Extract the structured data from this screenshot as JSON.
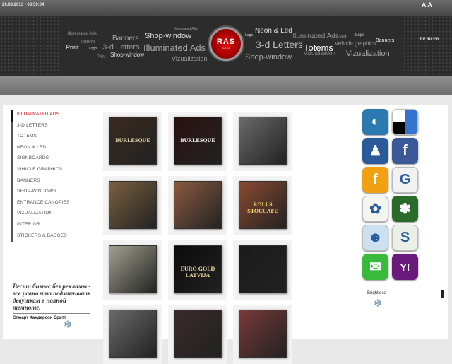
{
  "topbar": {
    "datetime": "29.03.2013 - 03:59:04",
    "font_size_control": "A A"
  },
  "header": {
    "logo_text": "RAS",
    "logo_subtext": "SIGNS",
    "langs": "Lv Ru En",
    "tag_cloud": [
      {
        "text": "Illuminated Ads",
        "color": "#9a9a9a"
      },
      {
        "text": "Banners",
        "color": "#aaaaaa"
      },
      {
        "text": "Shop-window",
        "color": "#e0e0e0"
      },
      {
        "text": "Illuminated Ads",
        "color": "#9a9a9a"
      },
      {
        "text": "Totems",
        "color": "#8a8a8a"
      },
      {
        "text": "Print",
        "color": "#ffffff"
      },
      {
        "text": "Logo",
        "color": "#cccccc"
      },
      {
        "text": "3-d Letters",
        "color": "#9a9a9a"
      },
      {
        "text": "Illuminated Ads",
        "color": "#a8a8a8"
      },
      {
        "text": "Print",
        "color": "#9a9a9a"
      },
      {
        "text": "Shop-window",
        "color": "#dddddd"
      },
      {
        "text": "Vizualization",
        "color": "#9a9a9a"
      },
      {
        "text": "Neon & Led",
        "color": "#dddddd"
      },
      {
        "text": "Logo",
        "color": "#cccccc"
      },
      {
        "text": "3-d Letters",
        "color": "#bbbbbb"
      },
      {
        "text": "Shop-window",
        "color": "#a8a8a8"
      },
      {
        "text": "Illuminated Ads",
        "color": "#999999"
      },
      {
        "text": "Print",
        "color": "#aaaaaa"
      },
      {
        "text": "Logo",
        "color": "#dddddd"
      },
      {
        "text": "Banners",
        "color": "#eeeeee"
      },
      {
        "text": "Totems",
        "color": "#ffffff"
      },
      {
        "text": "Vehicle graphics",
        "color": "#9a9a9a"
      },
      {
        "text": "Vizualization",
        "color": "#8a8a8a"
      },
      {
        "text": "Vizualization",
        "color": "#a8a8a8"
      }
    ]
  },
  "menu": [
    {
      "label": "ILLUMINATED ADS",
      "active": true
    },
    {
      "label": "3-D LETTERS",
      "active": false
    },
    {
      "label": "TOTEMS",
      "active": false
    },
    {
      "label": "NEON & LED",
      "active": false
    },
    {
      "label": "SIGNBOARDS",
      "active": false
    },
    {
      "label": "VIHICLE GRAPHICS",
      "active": false
    },
    {
      "label": "BANNERS",
      "active": false
    },
    {
      "label": "SHOP-WINDOWS",
      "active": false
    },
    {
      "label": "ENTRANCE CANOPIES",
      "active": false
    },
    {
      "label": "VIZUALIZATION",
      "active": false
    },
    {
      "label": "INTERIOR",
      "active": false
    },
    {
      "label": "STICKERS & BADGES",
      "active": false
    }
  ],
  "quote": {
    "text": "Вести бизнес без рекламы - все равно что подмигивать девушкам в полной темноте.",
    "author": "Стюарт Хандерсон Бритт"
  },
  "gallery": [
    {
      "sign": "BURLESQUE",
      "bg": "#3a2a20",
      "fg": "#e8d8b0"
    },
    {
      "sign": "BURLESQUE",
      "bg": "#2a1010",
      "fg": "#ffffff"
    },
    {
      "sign": "",
      "bg": "#6a6a6a",
      "fg": "#ffffff"
    },
    {
      "sign": "",
      "bg": "#7a6040",
      "fg": "#ffffff"
    },
    {
      "sign": "",
      "bg": "#8a5a40",
      "fg": "#ffffff"
    },
    {
      "sign": "ROLLS STOCCAFE",
      "bg": "#8a4a30",
      "fg": "#ffe070"
    },
    {
      "sign": "",
      "bg": "#a0a090",
      "fg": "#ffffff"
    },
    {
      "sign": "EURO GOLD LATVIJA",
      "bg": "#0a0a0a",
      "fg": "#f0e0a0"
    },
    {
      "sign": "",
      "bg": "#1a1a1a",
      "fg": "#ffffff"
    },
    {
      "sign": "",
      "bg": "#6a6a6a",
      "fg": "#ffffff"
    },
    {
      "sign": "",
      "bg": "#3a2a2a",
      "fg": "#ffffff"
    },
    {
      "sign": "",
      "bg": "#7a3a3a",
      "fg": "#ffffff"
    }
  ],
  "social": [
    {
      "name": "mixx-icon",
      "color": "#2a7ab0",
      "glyph": "◐"
    },
    {
      "name": "delicious-icon",
      "color": "#ffffff",
      "glyph": ""
    },
    {
      "name": "myspace-icon",
      "color": "#2a5a9a",
      "glyph": "♟"
    },
    {
      "name": "facebook-icon",
      "color": "#3b5998",
      "glyph": "f"
    },
    {
      "name": "furl-icon",
      "color": "#f0a010",
      "glyph": "f"
    },
    {
      "name": "google-icon",
      "color": "#f2f2f2",
      "glyph": "G"
    },
    {
      "name": "newsvine-icon",
      "color": "#f5f5f0",
      "glyph": "✿"
    },
    {
      "name": "evernote-icon",
      "color": "#2a6a2a",
      "glyph": "✽"
    },
    {
      "name": "reddit-icon",
      "color": "#cce0f0",
      "glyph": "☻"
    },
    {
      "name": "stumbleupon-icon",
      "color": "#e8f0e8",
      "glyph": "S"
    },
    {
      "name": "chat-icon",
      "color": "#3aba3a",
      "glyph": "✉"
    },
    {
      "name": "yahoo-icon",
      "color": "#6a1a7a",
      "glyph": "Y!"
    }
  ],
  "brightidea": "Brightidea"
}
